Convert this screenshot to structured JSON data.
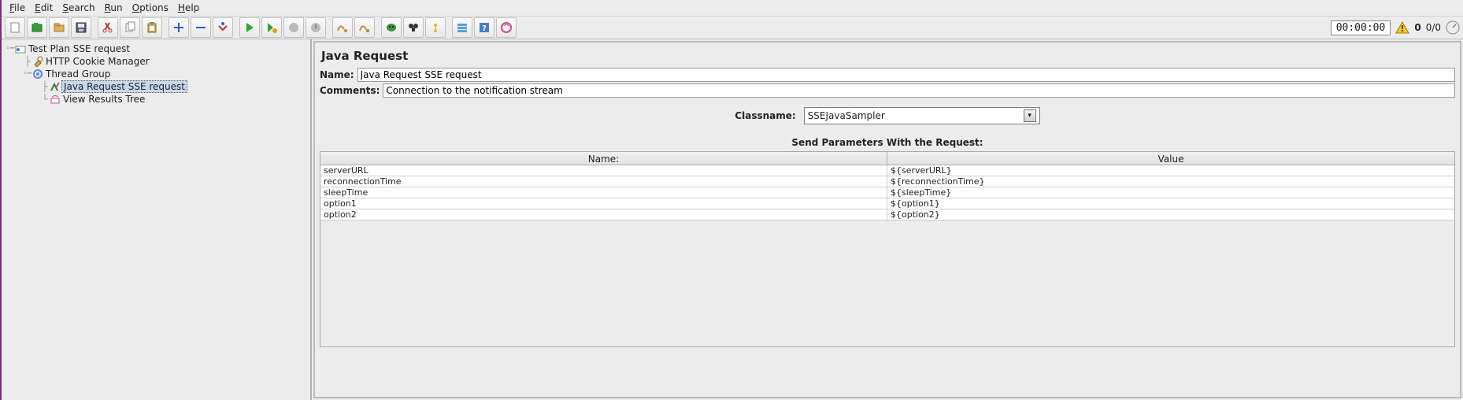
{
  "menubar": [
    "File",
    "Edit",
    "Search",
    "Run",
    "Options",
    "Help"
  ],
  "statusbar": {
    "timer": "00:00:00",
    "warn_count": "0",
    "threads": "0/0"
  },
  "tree": {
    "root": {
      "label": "Test Plan SSE request"
    },
    "cookie": {
      "label": "HTTP Cookie Manager"
    },
    "group": {
      "label": "Thread Group"
    },
    "request": {
      "label": "Java Request SSE request"
    },
    "results": {
      "label": "View Results Tree"
    }
  },
  "editor": {
    "title": "Java Request",
    "name_label": "Name:",
    "name_value": "Java Request SSE request",
    "comments_label": "Comments:",
    "comments_value": "Connection to the notification stream",
    "classname_label": "Classname:",
    "classname_value": "SSEJavaSampler",
    "params_title": "Send Parameters With the Request:",
    "columns": {
      "name": "Name:",
      "value": "Value"
    },
    "params": [
      {
        "name": "serverURL",
        "value": "${serverURL}"
      },
      {
        "name": "reconnectionTime",
        "value": "${reconnectionTime}"
      },
      {
        "name": "sleepTime",
        "value": "${sleepTime}"
      },
      {
        "name": "option1",
        "value": "${option1}"
      },
      {
        "name": "option2",
        "value": "${option2}"
      }
    ]
  }
}
